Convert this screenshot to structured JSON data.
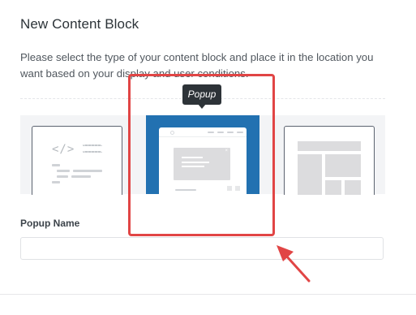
{
  "header": {
    "title": "New Content Block",
    "description": "Please select the type of your content block and place it in the location you want based on your display and user conditions."
  },
  "block_types": [
    {
      "id": "code",
      "icon": "code-icon",
      "glyph": "</>"
    },
    {
      "id": "popup",
      "icon": "popup-icon",
      "tooltip": "Popup",
      "selected": true
    },
    {
      "id": "layout",
      "icon": "layout-icon"
    }
  ],
  "form": {
    "name_label": "Popup Name",
    "name_value": "",
    "name_placeholder": ""
  },
  "annotation": {
    "highlight_color": "#e14545",
    "accent_color": "#2271b1"
  }
}
